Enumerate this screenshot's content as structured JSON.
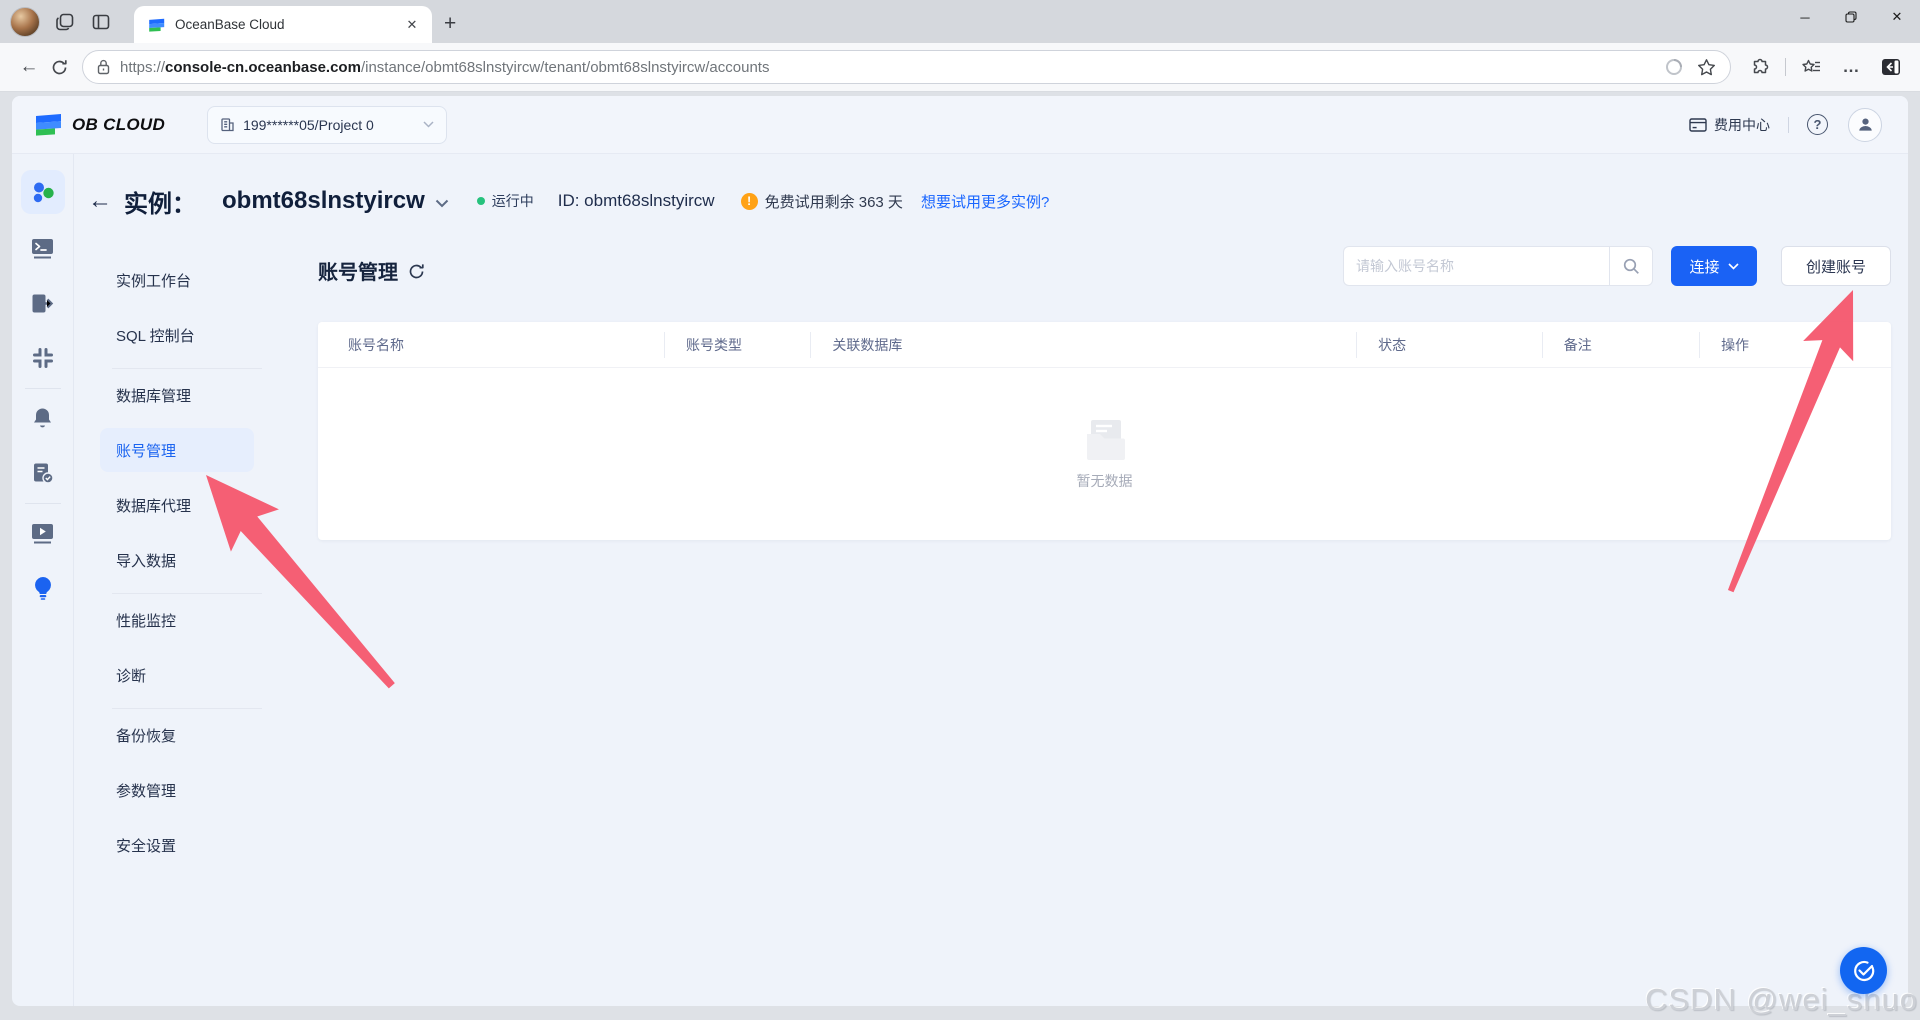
{
  "browser": {
    "tab_title": "OceanBase Cloud",
    "url": {
      "scheme": "https://",
      "host": "console-cn.oceanbase.com",
      "path": "/instance/obmt68slnstyircw/tenant/obmt68slnstyircw/accounts"
    }
  },
  "icons": {
    "close": "✕",
    "new_tab": "+",
    "minimize": "─",
    "more": "…",
    "back": "←",
    "help": "?",
    "warning": "!"
  },
  "header": {
    "logo_text": "OB CLOUD",
    "project_selector": "199******05/Project 0",
    "billing_label": "费用中心"
  },
  "instance_bar": {
    "label": "实例：",
    "name": "obmt68slnstyircw",
    "status": "运行中",
    "id_text": "ID: obmt68slnstyircw",
    "trial_text": "免费试用剩余 363 天",
    "trial_link": "想要试用更多实例?"
  },
  "sidebar": {
    "items": [
      {
        "label": "实例工作台",
        "active": false
      },
      {
        "label": "SQL 控制台",
        "active": false
      },
      {
        "label": "数据库管理",
        "active": false
      },
      {
        "label": "账号管理",
        "active": true
      },
      {
        "label": "数据库代理",
        "active": false
      },
      {
        "label": "导入数据",
        "active": false
      },
      {
        "label": "性能监控",
        "active": false
      },
      {
        "label": "诊断",
        "active": false
      },
      {
        "label": "备份恢复",
        "active": false
      },
      {
        "label": "参数管理",
        "active": false
      },
      {
        "label": "安全设置",
        "active": false
      }
    ]
  },
  "content": {
    "title": "账号管理",
    "search_placeholder": "请输入账号名称",
    "connect_label": "连接",
    "create_label": "创建账号",
    "columns": [
      "账号名称",
      "账号类型",
      "关联数据库",
      "状态",
      "备注",
      "操作"
    ],
    "empty_text": "暂无数据"
  },
  "watermark": "CSDN @wei_shuo",
  "colors": {
    "accent_blue": "#1a62f5",
    "link_blue": "#1a66ff",
    "status_green": "#26c27d",
    "warning_orange": "#ffa216",
    "annotation_arrow": "#f4566d"
  }
}
